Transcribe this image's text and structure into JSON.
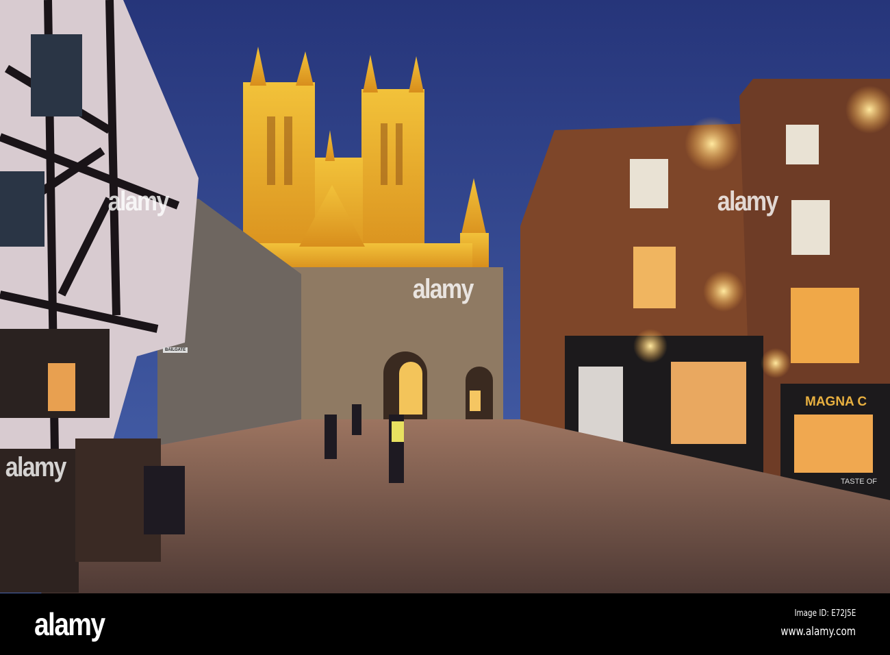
{
  "photo": {
    "signs": {
      "pub_name": "MAGNA C",
      "pub_subsign": "TASTE OF",
      "street_sign": "BAILGATE"
    },
    "watermarks": [
      "alamy",
      "alamy",
      "alamy",
      "alamy"
    ],
    "colors": {
      "sky": "#2d3f86",
      "cathedral": "#e6a92a",
      "cobbles": "#6e5347",
      "brick": "#8a4a2c"
    }
  },
  "footer": {
    "logo": "alamy",
    "image_id": "Image ID: E72J5E",
    "website": "www.alamy.com"
  }
}
